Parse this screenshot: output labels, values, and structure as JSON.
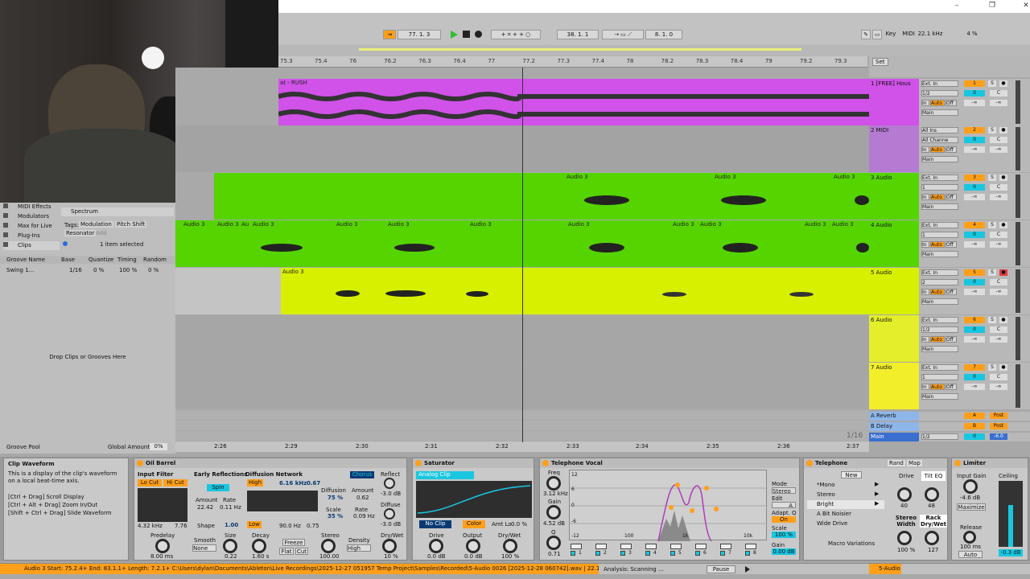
{
  "window": {
    "minimize": "–",
    "maximize": "❐",
    "close": "✕"
  },
  "transport": {
    "pos1": "77.  1.  3",
    "pos2": "38.  1.  1",
    "pos3": "8.  1.  0",
    "key_label": "Key",
    "midi_label": "MIDI",
    "sample_rate": "22.1 kHz",
    "cpu": "4 %"
  },
  "ruler": {
    "ticks": [
      "75.3",
      "75.4",
      "76",
      "76.2",
      "76.3",
      "76.4",
      "77",
      "77.2",
      "77.3",
      "77.4",
      "78",
      "78.2",
      "78.3",
      "78.4",
      "79",
      "79.2",
      "79.3"
    ],
    "set_label": "Set"
  },
  "time_ruler": {
    "ticks": [
      "2:26",
      "2:29",
      "2:30",
      "2:31",
      "2:32",
      "2:33",
      "2:34",
      "2:35",
      "2:36",
      "2:37"
    ],
    "zoom": "1/16"
  },
  "tracks": [
    {
      "name": "1 [FREE] Hous",
      "num": "1",
      "input": "Ext. In",
      "channel": "1/2",
      "out": "Main",
      "vol": "0",
      "pan": "C",
      "color": "#d052e8"
    },
    {
      "name": "2 MIDI",
      "num": "2",
      "input": "All Ins",
      "channel": "All Channe",
      "out": "Main",
      "vol": "0",
      "pan": "C",
      "color": "#b57ad1"
    },
    {
      "name": "3 Audio",
      "num": "3",
      "input": "Ext. In",
      "channel": "1",
      "out": "Main",
      "vol": "0",
      "pan": "C",
      "color": "#55d400"
    },
    {
      "name": "4 Audio",
      "num": "4",
      "input": "Ext. In",
      "channel": "1",
      "out": "Main",
      "vol": "0",
      "pan": "C",
      "color": "#55d400"
    },
    {
      "name": "5 Audio",
      "num": "5",
      "input": "Ext. In",
      "channel": "2",
      "out": "Main",
      "vol": "0",
      "pan": "C",
      "color": "#d7f000"
    },
    {
      "name": "6 Audio",
      "num": "6",
      "input": "Ext. In",
      "channel": "1/2",
      "out": "Main",
      "vol": "0",
      "pan": "C",
      "color": "#e4ee2a"
    },
    {
      "name": "7 Audio",
      "num": "7",
      "input": "Ext. In",
      "channel": "1",
      "out": "Main",
      "vol": "0",
      "pan": "C",
      "color": "#f2ee2a"
    }
  ],
  "mixer_labels": {
    "in": "In",
    "auto": "Auto",
    "off": "Off",
    "inf": "-∞",
    "s": "S"
  },
  "returns": [
    {
      "name": "A Reverb",
      "letter": "A",
      "post": "Post"
    },
    {
      "name": "B Delay",
      "letter": "B",
      "post": "Post"
    },
    {
      "name": "Main",
      "channel": "1/2",
      "vol": "0",
      "db": "-6.0"
    }
  ],
  "clips": {
    "track1": "at - RUSH",
    "audio3": "Audio 3",
    "audio3_short": "Au"
  },
  "browser": {
    "items": [
      "MIDI Effects",
      "Modulators",
      "Max for Live",
      "Plug-Ins",
      "Clips"
    ],
    "spectrum": "Spectrum",
    "tags_label": "Tags:",
    "tags": [
      "Modulation",
      "Pitch Shift",
      "Resonator",
      "Add"
    ],
    "selected": "1 item selected",
    "groove_headers": [
      "Groove Name",
      "Base",
      "Quantize",
      "Timing",
      "Random"
    ],
    "groove_row": [
      "Swing 1...",
      "1/16",
      "0 %",
      "100 %",
      "0 %"
    ],
    "drop_hint": "Drop Clips or Grooves Here",
    "groove_pool": "Groove Pool",
    "global_amount_label": "Global Amount",
    "global_amount": "0%"
  },
  "info": {
    "title": "Clip Waveform",
    "text": "This is a display of the clip's waveform on a local beat-time axis.",
    "line1": "[Ctrl + Drag] Scroll Display",
    "line2": "[Ctrl + Alt + Drag] Zoom In/Out",
    "line3": "[Shift + Ctrl + Drag] Slide Waveform"
  },
  "oil_barrel": {
    "title": "Oil Barrel",
    "input_filter": "Input Filter",
    "lo_cut": "Lo Cut",
    "hi_cut": "Hi Cut",
    "freq": "4.32 kHz",
    "q": "7.76",
    "early": "Early Reflections",
    "spin": "Spin",
    "amount_label": "Amount",
    "rate_label": "Rate",
    "amount": "22.42",
    "rate": "0.11 Hz",
    "shape_label": "Shape",
    "shape": "1.00",
    "diffusion": "Diffusion Network",
    "high": "High",
    "hz": "6.16 kHz",
    "hval": "0.67",
    "low": "Low",
    "low_hz": "90.0 Hz",
    "lval": "0.75",
    "diff_label": "Diffusion",
    "diff": "75 %",
    "scale_label": "Scale",
    "scale": "35 %",
    "chorus": "Chorus",
    "ch_amount": "0.62",
    "ch_rate": "0.09 Hz",
    "reflect": "Reflect",
    "reflect_val": "-3.0 dB",
    "diffuse": "Diffuse",
    "diffuse_val": "-3.0 dB",
    "predelay_label": "Predelay",
    "predelay": "8.00 ms",
    "smooth_label": "Smooth",
    "smooth": "None",
    "size_label": "Size",
    "size": "0.22",
    "decay_label": "Decay",
    "decay": "1.60 s",
    "freeze": "Freeze",
    "flat": "Flat",
    "cut": "Cut",
    "stereo_label": "Stereo",
    "stereo": "100.00",
    "density_label": "Density",
    "density": "High",
    "drywet_label": "Dry/Wet",
    "drywet": "10 %"
  },
  "saturator": {
    "title": "Saturator",
    "mode": "Analog Clip",
    "no_clip": "No Clip",
    "color": "Color",
    "amt_lo_label": "Amt Lo",
    "amt_lo": "0.0 %",
    "drive_label": "Drive",
    "drive": "0.0 dB",
    "output_label": "Output",
    "output": "0.0 dB",
    "drywet_label": "Dry/Wet",
    "drywet": "100 %"
  },
  "telephone_vocal": {
    "title": "Telephone Vocal",
    "freq_label": "Freq",
    "freq": "3.12 kHz",
    "gain_label": "Gain",
    "gain": "4.52 dB",
    "q_label": "Q",
    "q": "0.71",
    "yticks": [
      "12",
      "6",
      "0",
      "-6",
      "-12"
    ],
    "xticks": [
      "100",
      "1k",
      "10k"
    ],
    "mode_label": "Mode",
    "mode": "Stereo",
    "edit_label": "Edit",
    "edit": "A",
    "adapt": "Adapt. Q",
    "on": "On",
    "scale_label": "Scale",
    "scale": "100 %",
    "gain2_label": "Gain",
    "gain2": "0.00 dB",
    "bands": [
      "1",
      "2",
      "3",
      "4",
      "5",
      "6",
      "7",
      "8"
    ]
  },
  "telephone": {
    "title": "Telephone",
    "rand": "Rand",
    "map": "Map",
    "new": "New",
    "presets": [
      "*Mono",
      "Stereo",
      "Bright",
      "A Bit Noisier",
      "Wide Drive"
    ],
    "macro": "Macro Variations",
    "drive_label": "Drive",
    "drive": "40",
    "tilt_label": "Tilt EQ",
    "tilt": "48",
    "width_label": "Stereo Width",
    "width": "100 %",
    "rack_label": "Rack Dry/Wet",
    "rack": "127"
  },
  "limiter": {
    "title": "Limiter",
    "input_gain_label": "Input Gain",
    "input_gain": "-4.6 dB",
    "ceiling_label": "Ceiling",
    "maximize": "Maximize",
    "release_label": "Release",
    "release": "100 ms",
    "auto": "Auto",
    "ceiling": "-0.3 dB"
  },
  "status": {
    "clip_info": "Audio 3  Start: 75.2.4+  End: 83.1.1+  Length: 7.2.1+  C:\\Users\\dylan\\Documents\\Ableton\\Live Recordings\\2025-12-27 051957 Temp Project\\Samples\\Recorded\\5-Audio 0026 [2025-12-28 060742].wav | 22.1 kHz | 24 Bit | 1",
    "analysis": "Analysis: Scanning ...",
    "pause": "Pause",
    "track": "5-Audio"
  },
  "colors": {
    "orange": "#ff9f1a",
    "cyan": "#14c8e0",
    "magenta": "#d052e8",
    "green": "#55d400",
    "yellow": "#d7f000"
  }
}
